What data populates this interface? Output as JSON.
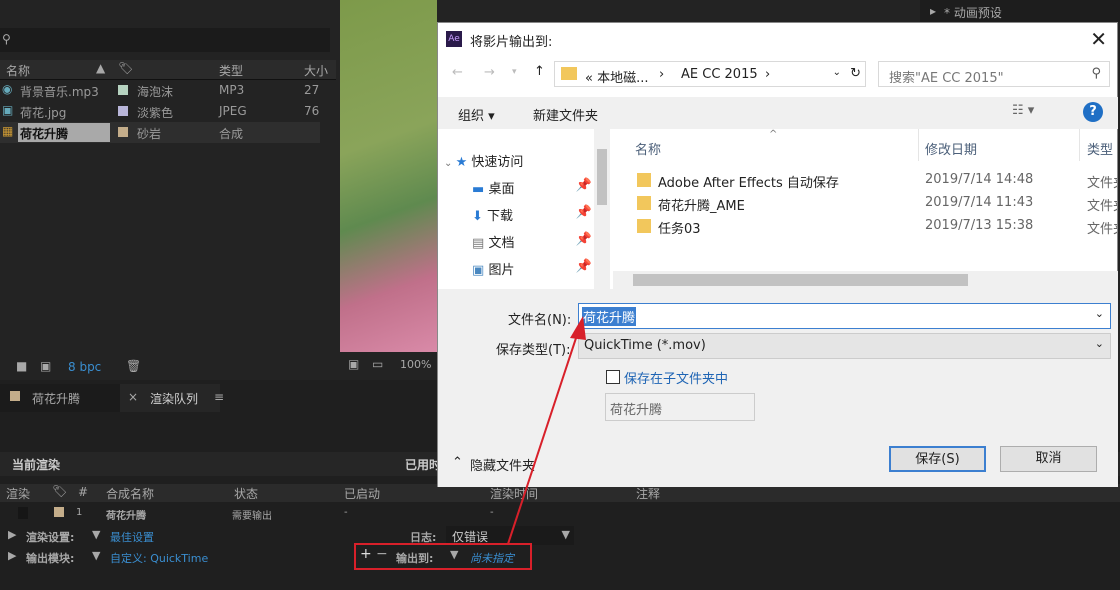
{
  "project": {
    "columns": [
      "名称",
      "类型",
      "大小"
    ],
    "items": [
      {
        "name": "背景音乐.mp3",
        "label": "海泡沫",
        "color": "#b6d2c0",
        "type": "MP3",
        "size": "27"
      },
      {
        "name": "荷花.jpg",
        "label": "淡紫色",
        "color": "#b9b6d9",
        "type": "JPEG",
        "size": "76"
      },
      {
        "name": "荷花升腾",
        "label": "砂岩",
        "color": "#c4ad8a",
        "type": "合成",
        "size": ""
      }
    ],
    "bpc": "8 bpc"
  },
  "viewer": {
    "zoom": "100%"
  },
  "effects_panel": {
    "title": "* 动画预设"
  },
  "tabs": [
    {
      "label": "荷花升腾"
    },
    {
      "label": "渲染队列"
    }
  ],
  "render_queue": {
    "current_render": "当前渲染",
    "elapsed": "已用时",
    "columns": [
      "渲染",
      "#",
      "合成名称",
      "状态",
      "已启动",
      "渲染时间",
      "注释"
    ],
    "item": {
      "num": "1",
      "comp": "荷花升腾",
      "status": "需要输出",
      "started": "-",
      "time": "-"
    },
    "render_settings_label": "渲染设置:",
    "render_settings_value": "最佳设置",
    "log_label": "日志:",
    "log_value": "仅错误",
    "output_module_label": "输出模块:",
    "output_module_value": "自定义: QuickTime",
    "output_to_label": "输出到:",
    "output_to_value": "尚未指定"
  },
  "dialog": {
    "title": "将影片输出到:",
    "breadcrumb": [
      "« 本地磁...",
      "AE CC 2015"
    ],
    "search_placeholder": "搜索\"AE CC 2015\"",
    "organize": "组织 ▾",
    "new_folder": "新建文件夹",
    "nav": [
      "快速访问",
      "桌面",
      "下载",
      "文档",
      "图片"
    ],
    "columns": [
      "名称",
      "修改日期",
      "类型"
    ],
    "files": [
      {
        "name": "Adobe After Effects 自动保存",
        "date": "2019/7/14 14:48",
        "type": "文件夹"
      },
      {
        "name": "荷花升腾_AME",
        "date": "2019/7/14 11:43",
        "type": "文件夹"
      },
      {
        "name": "任务03",
        "date": "2019/7/13 15:38",
        "type": "文件夹"
      }
    ],
    "filename_label": "文件名(N):",
    "filename_value": "荷花升腾",
    "type_label": "保存类型(T):",
    "type_value": "QuickTime (*.mov)",
    "subfolder_label": "保存在子文件夹中",
    "subfolder_value": "荷花升腾",
    "hide_folders": "隐藏文件夹",
    "save": "保存(S)",
    "cancel": "取消"
  }
}
